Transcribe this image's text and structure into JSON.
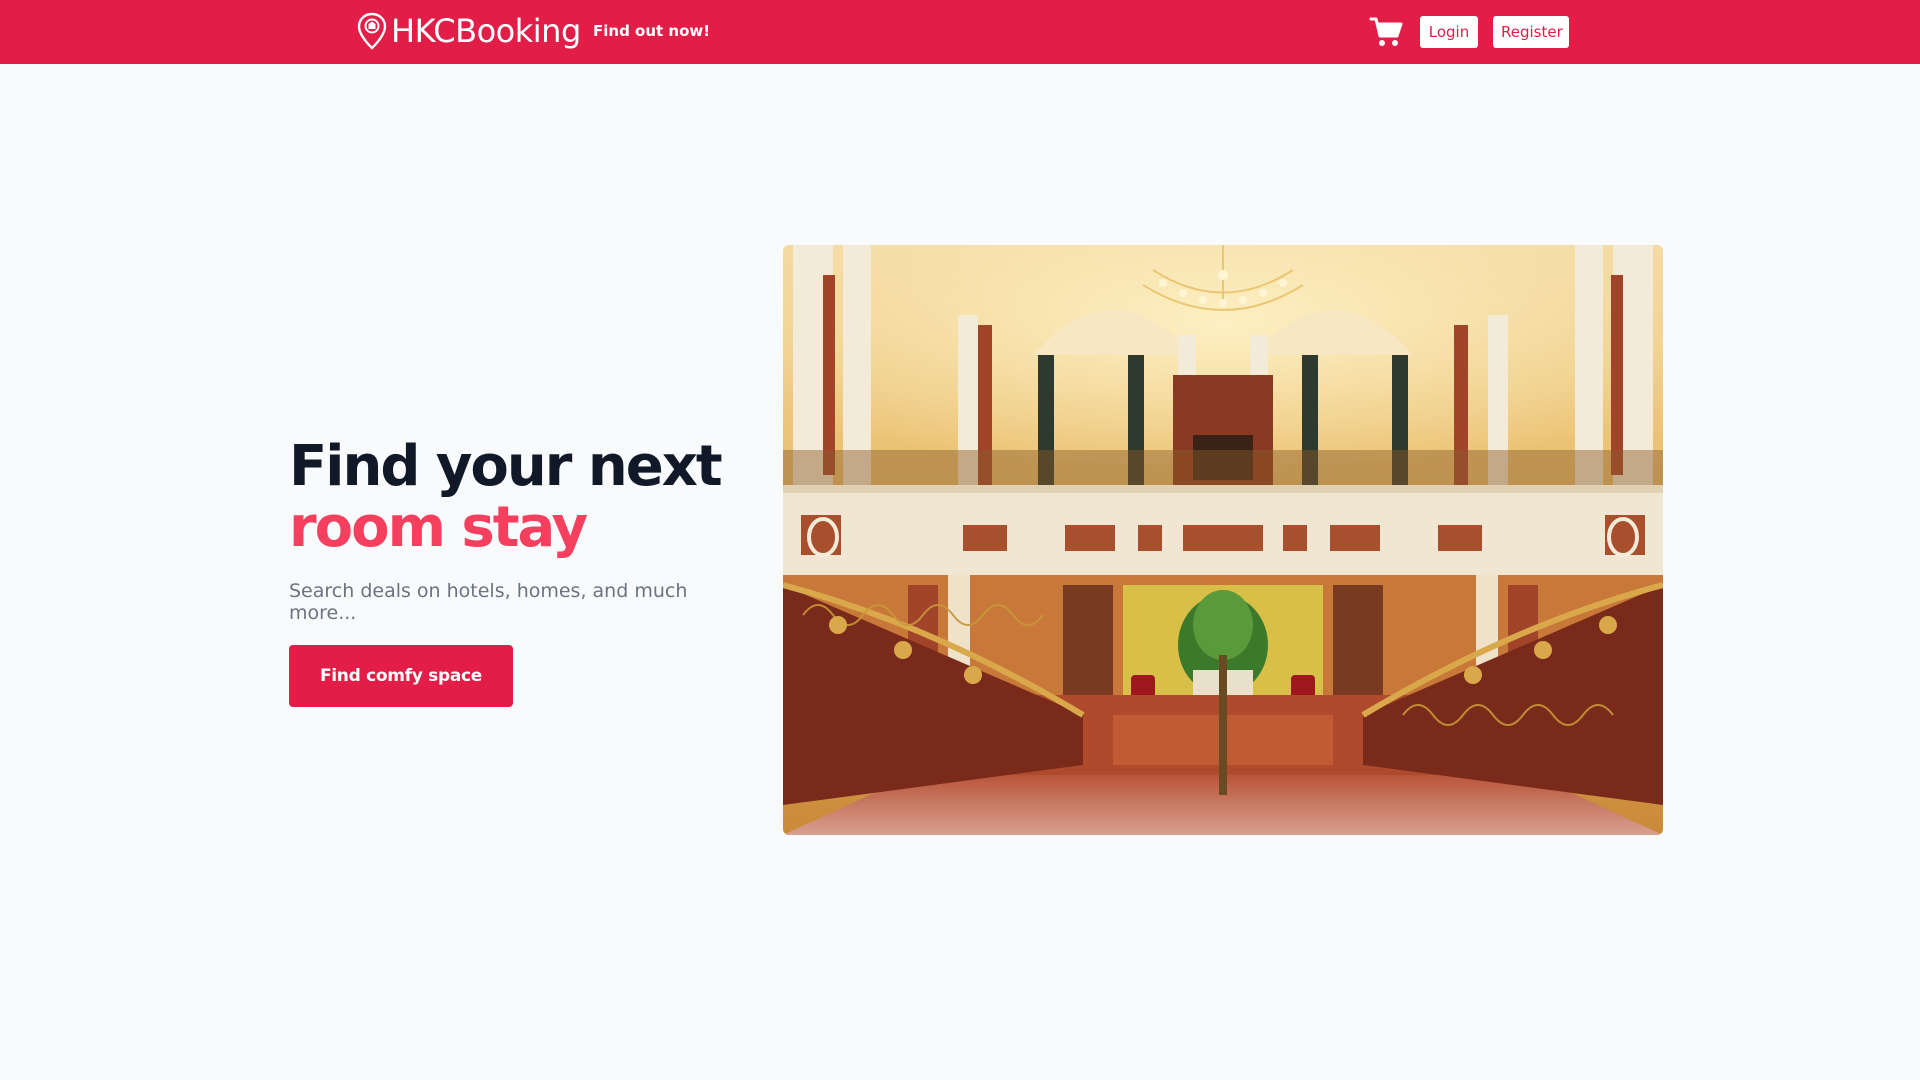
{
  "navbar": {
    "brand": "HKCBooking",
    "link": "Find out now!",
    "login_label": "Login",
    "register_label": "Register",
    "accent_color": "#e11d48"
  },
  "hero": {
    "headline_line1": "Find your next",
    "headline_line2": "room stay",
    "subtitle": "Search deals on hotels, homes, and much more...",
    "cta_label": "Find comfy space",
    "image_description_icon": "hotel-lobby-photo"
  },
  "icons": {
    "brand": "location-pin-icon",
    "cart": "shopping-cart-icon"
  }
}
